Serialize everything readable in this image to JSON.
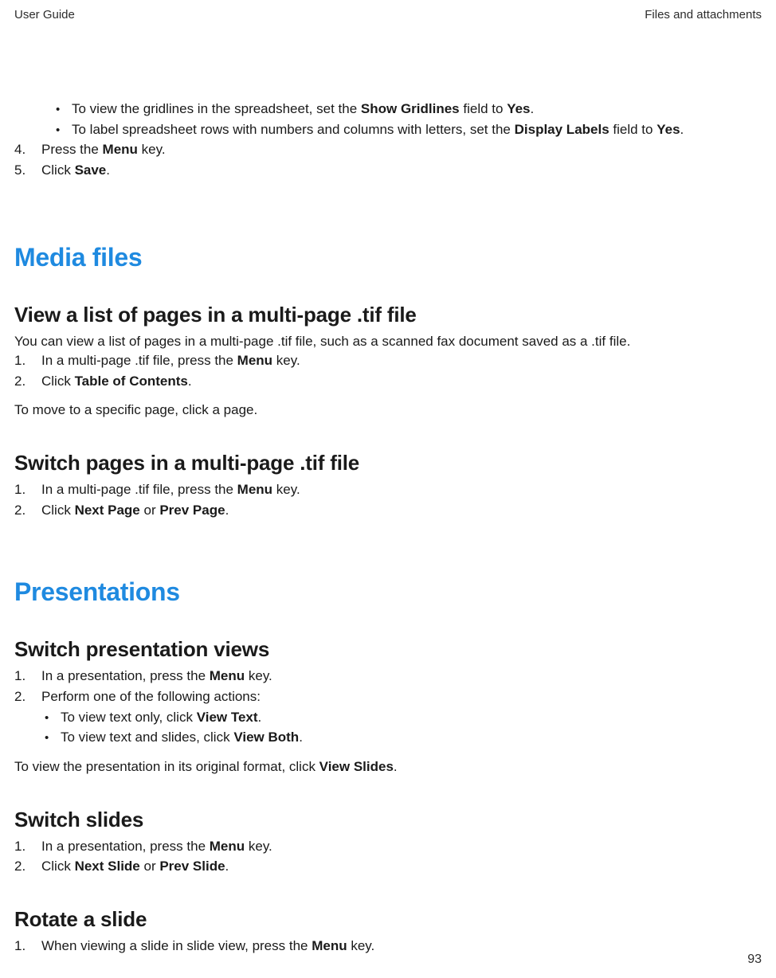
{
  "header": {
    "left": "User Guide",
    "right": "Files and attachments"
  },
  "pageNumber": "93",
  "intro": {
    "bullets": [
      {
        "pre": "To view the gridlines in the spreadsheet, set the ",
        "bold1": "Show Gridlines",
        "mid": " field to ",
        "bold2": "Yes",
        "post": "."
      },
      {
        "pre": "To label spreadsheet rows with numbers and columns with letters, set the ",
        "bold1": "Display Labels",
        "mid": " field to ",
        "bold2": "Yes",
        "post": "."
      }
    ],
    "steps": [
      {
        "num": "4.",
        "pre": "Press the ",
        "bold1": "Menu",
        "post": " key."
      },
      {
        "num": "5.",
        "pre": "Click ",
        "bold1": "Save",
        "post": "."
      }
    ]
  },
  "mediaFiles": {
    "title": "Media files",
    "viewTif": {
      "heading": "View a list of pages in a multi-page .tif file",
      "lead": "You can view a list of pages in a multi-page .tif file, such as a scanned fax document saved as a .tif file.",
      "steps": [
        {
          "num": "1.",
          "pre": "In a multi-page .tif file, press the ",
          "bold1": "Menu",
          "post": " key."
        },
        {
          "num": "2.",
          "pre": "Click ",
          "bold1": "Table of Contents",
          "post": "."
        }
      ],
      "trail": "To move to a specific page, click a page."
    },
    "switchTif": {
      "heading": "Switch pages in a multi-page .tif file",
      "steps": [
        {
          "num": "1.",
          "pre": "In a multi-page .tif file, press the ",
          "bold1": "Menu",
          "post": " key."
        },
        {
          "num": "2.",
          "pre": "Click ",
          "bold1": "Next Page",
          "mid": " or ",
          "bold2": "Prev Page",
          "post": "."
        }
      ]
    }
  },
  "presentations": {
    "title": "Presentations",
    "switchViews": {
      "heading": "Switch presentation views",
      "steps": [
        {
          "num": "1.",
          "pre": "In a presentation, press the ",
          "bold1": "Menu",
          "post": " key."
        },
        {
          "num": "2.",
          "plain": "Perform one of the following actions:"
        }
      ],
      "bullets": [
        {
          "pre": "To view text only, click ",
          "bold1": "View Text",
          "post": "."
        },
        {
          "pre": "To view text and slides, click ",
          "bold1": "View Both",
          "post": "."
        }
      ],
      "trail_pre": "To view the presentation in its original format, click ",
      "trail_bold": "View Slides",
      "trail_post": "."
    },
    "switchSlides": {
      "heading": "Switch slides",
      "steps": [
        {
          "num": "1.",
          "pre": "In a presentation, press the ",
          "bold1": "Menu",
          "post": " key."
        },
        {
          "num": "2.",
          "pre": "Click ",
          "bold1": "Next Slide",
          "mid": " or ",
          "bold2": "Prev Slide",
          "post": "."
        }
      ]
    },
    "rotateSlide": {
      "heading": "Rotate a slide",
      "steps": [
        {
          "num": "1.",
          "pre": "When viewing a slide in slide view, press the ",
          "bold1": "Menu",
          "post": " key."
        }
      ]
    }
  }
}
